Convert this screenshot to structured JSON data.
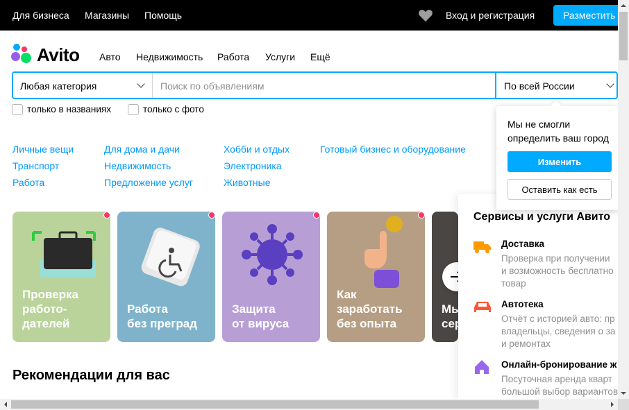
{
  "topbar": {
    "links": [
      "Для бизнеса",
      "Магазины",
      "Помощь"
    ],
    "login": "Вход и регистрация",
    "post_button": "Разместить"
  },
  "logo": {
    "text": "Avito"
  },
  "nav": [
    "Авто",
    "Недвижимость",
    "Работа",
    "Услуги",
    "Ещё"
  ],
  "search": {
    "category": "Любая категория",
    "placeholder": "Поиск по объявлениям",
    "region": "По всей России"
  },
  "filters": {
    "titles_only": "только в названиях",
    "with_photo": "только с фото"
  },
  "categories": {
    "col1": [
      "Личные вещи",
      "Транспорт",
      "Работа"
    ],
    "col2": [
      "Для дома и дачи",
      "Недвижимость",
      "Предложение услуг"
    ],
    "col3": [
      "Хобби и отдых",
      "Электроника",
      "Животные"
    ],
    "col4": [
      "Готовый бизнес и оборудование"
    ]
  },
  "city_popup": {
    "message": "Мы не смогли определить ваш город",
    "change_button": "Изменить",
    "keep_button": "Оставить как есть"
  },
  "stories": [
    {
      "title": "Проверка работо-дателей",
      "line1": "Проверка",
      "line2": "работо-",
      "line3": "дателей",
      "bg": "#b9d39a"
    },
    {
      "title": "Работа без преград",
      "line1": "",
      "line2": "Работа",
      "line3": "без преград",
      "bg": "#7fb3cc"
    },
    {
      "title": "Защита от вируса",
      "line1": "",
      "line2": "Защита",
      "line3": "от вируса",
      "bg": "#b79fd6"
    },
    {
      "title": "Как заработать без опыта",
      "line1": "Как",
      "line2": "заработать",
      "line3": "без опыта",
      "bg": "#b59e83"
    },
    {
      "title": "Мы сер",
      "line1": "",
      "line2": "Мы",
      "line3": "сер",
      "bg": "#4a4644"
    }
  ],
  "services": {
    "heading": "Сервисы и услуги Авито",
    "items": [
      {
        "title": "Доставка",
        "desc1": "Проверка при получении",
        "desc2": "и возможность бесплатно",
        "desc3": "товар",
        "icon": "truck-icon",
        "color": "#ff9900"
      },
      {
        "title": "Автотека",
        "desc1": "Отчёт с историей авто: пр",
        "desc2": "владельцы, сведения о за",
        "desc3": "и ремонтах",
        "icon": "car-icon",
        "color": "#ff5533"
      },
      {
        "title": "Онлайн-бронирование ж",
        "desc1": "Посуточная аренда кварт",
        "desc2": "большой выбор вариантов",
        "desc3": "",
        "icon": "house-icon",
        "color": "#9966ee"
      }
    ]
  },
  "recommendations": {
    "heading": "Рекомендации для вас"
  },
  "colors": {
    "accent": "#00aaff",
    "link": "#0099f7",
    "badge": "#ff3366"
  }
}
